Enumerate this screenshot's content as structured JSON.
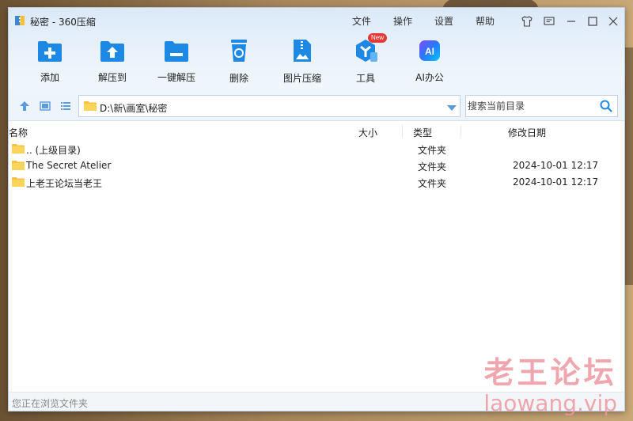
{
  "window": {
    "title": "秘密 - 360压缩"
  },
  "menu": {
    "file": "文件",
    "operate": "操作",
    "settings": "设置",
    "help": "帮助"
  },
  "toolbar": {
    "items": [
      {
        "label": "添加",
        "icon": "add-icon"
      },
      {
        "label": "解压到",
        "icon": "extract-to-icon"
      },
      {
        "label": "一键解压",
        "icon": "one-click-extract-icon"
      },
      {
        "label": "删除",
        "icon": "delete-icon"
      },
      {
        "label": "图片压缩",
        "icon": "image-compress-icon"
      },
      {
        "label": "工具",
        "icon": "tools-icon",
        "badge": "New"
      },
      {
        "label": "AI办公",
        "icon": "ai-office-icon",
        "icon_text": "AI"
      }
    ]
  },
  "address": {
    "path": "D:\\新\\画室\\秘密"
  },
  "search": {
    "placeholder": "搜索当前目录"
  },
  "columns": {
    "name": "名称",
    "size": "大小",
    "type": "类型",
    "modified": "修改日期"
  },
  "files": [
    {
      "name": ".. (上级目录)",
      "type": "文件夹",
      "modified": ""
    },
    {
      "name": "The Secret Atelier",
      "type": "文件夹",
      "modified": "2024-10-01 12:17"
    },
    {
      "name": "上老王论坛当老王",
      "type": "文件夹",
      "modified": "2024-10-01 12:17"
    }
  ],
  "status": {
    "text": "您正在浏览文件夹"
  },
  "watermark": {
    "line1": "老王论坛",
    "line2": "laowang.vip"
  },
  "colors": {
    "accent": "#1e88e5",
    "folder": "#f5c342",
    "badge": "#e53935"
  }
}
